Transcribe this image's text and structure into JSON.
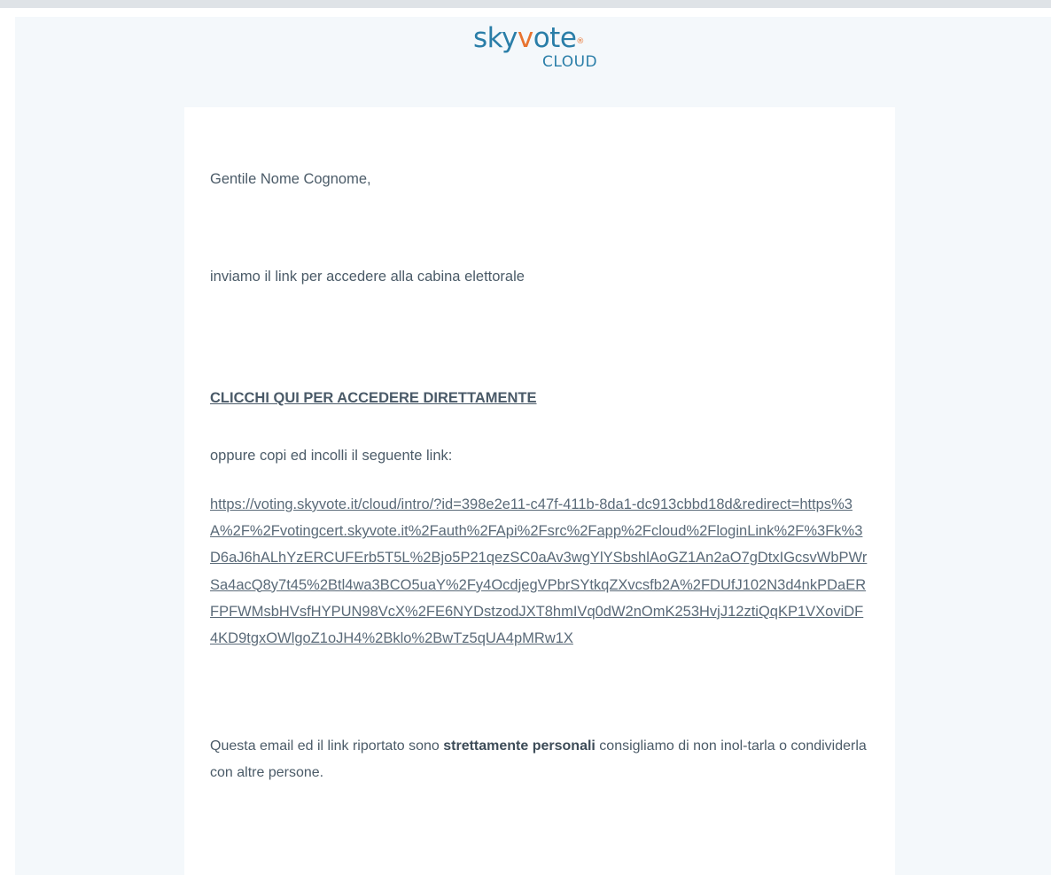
{
  "logo": {
    "word_part1": "sky",
    "word_v": "v",
    "word_part2": "ote",
    "registered": "®",
    "subtitle": "CLOUD",
    "colors": {
      "primary": "#2a7ea8",
      "accent": "#e8732f"
    }
  },
  "email": {
    "greeting": "Gentile Nome Cognome,",
    "intro": "inviamo il link per accedere alla cabina elettorale",
    "cta_label": "CLICCHI QUI PER ACCEDERE DIRETTAMENTE",
    "alt_instruction": "oppure copi ed incolli il seguente link:",
    "link_url": "https://voting.skyvote.it/cloud/intro/?id=398e2e11-c47f-411b-8da1-dc913cbbd18d&redirect=https%3A%2F%2Fvotingcert.skyvote.it%2Fauth%2FApi%2Fsrc%2Fapp%2Fcloud%2FloginLink%2F%3Fk%3D6aJ6hALhYzERCUFErb5T5L%2Bjo5P21qezSC0aAv3wgYlYSbshlAoGZ1An2aO7gDtxIGcsvWbPWrSa4acQ8y7t45%2Btl4wa3BCO5uaY%2Fy4OcdjegVPbrSYtkqZXvcsfb2A%2FDUfJ102N3d4nkPDaERFPFWMsbHVsfHYPUN98VcX%2FE6NYDstzodJXT8hmIVq0dW2nOmK253HvjJ12ztiQqKP1VXoviDF4KD9tgxOWlgoZ1oJH4%2Bklo%2BwTz5qUA4pMRw1X",
    "note_before": "Questa email ed il link riportato sono ",
    "note_bold": "strettamente personali",
    "note_after": " consigliamo di non inol-tarla o condividerla con altre persone."
  }
}
